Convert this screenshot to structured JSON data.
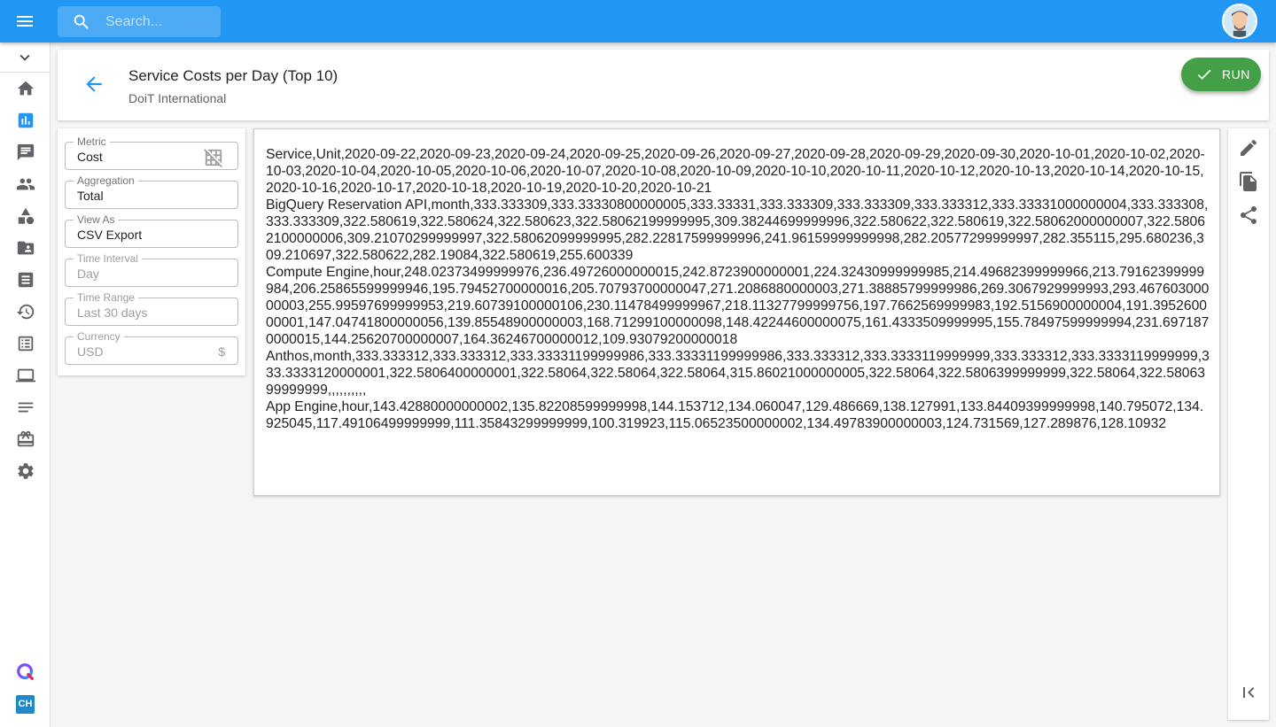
{
  "topbar": {
    "search_placeholder": "Search...",
    "brand_color": "#2196f3"
  },
  "sidebar": {
    "items": [
      "home-icon",
      "reports-icon",
      "chat-icon",
      "people-icon",
      "shapes-icon",
      "folder-icon",
      "invoice-icon",
      "history-icon",
      "list-icon",
      "laptop-icon",
      "notes-icon",
      "briefcase-icon",
      "settings-icon"
    ],
    "active": "reports-icon",
    "bottom_apps": [
      "q-logo-icon",
      "ch-logo-icon"
    ],
    "ch_label": "CH"
  },
  "header": {
    "title": "Service Costs per Day (Top 10)",
    "subtitle": "DoiT International",
    "run_label": "RUN"
  },
  "config": {
    "metric": {
      "label": "Metric",
      "value": "Cost"
    },
    "aggregation": {
      "label": "Aggregation",
      "value": "Total"
    },
    "view_as": {
      "label": "View As",
      "value": "CSV Export"
    },
    "time_interval": {
      "label": "Time Interval",
      "value": "Day"
    },
    "time_range": {
      "label": "Time Range",
      "value": "Last 30 days"
    },
    "currency": {
      "label": "Currency",
      "value": "USD",
      "symbol": "$"
    }
  },
  "csv_output": "Service,Unit,2020-09-22,2020-09-23,2020-09-24,2020-09-25,2020-09-26,2020-09-27,2020-09-28,2020-09-29,2020-09-30,2020-10-01,2020-10-02,2020-10-03,2020-10-04,2020-10-05,2020-10-06,2020-10-07,2020-10-08,2020-10-09,2020-10-10,2020-10-11,2020-10-12,2020-10-13,2020-10-14,2020-10-15,2020-10-16,2020-10-17,2020-10-18,2020-10-19,2020-10-20,2020-10-21\nBigQuery Reservation API,month,333.333309,333.33330800000005,333.33331,333.333309,333.333309,333.333312,333.33331000000004,333.333308,333.333309,322.580619,322.580624,322.580623,322.58062199999995,309.38244699999996,322.580622,322.580619,322.58062000000007,322.58062100000006,309.21070299999997,322.58062099999995,282.22817599999996,241.96159999999998,282.20577299999997,282.355115,295.680236,309.210697,322.580622,282.19084,322.580619,255.600339\nCompute Engine,hour,248.02373499999976,236.49726000000015,242.8723900000001,224.32430999999985,214.49682399999966,213.79162399999984,206.25865599999946,195.79452700000016,205.70793700000047,271.2086880000003,271.38885799999986,269.3067929999993,293.46760300000003,255.99597699999953,219.60739100000106,230.11478499999967,218.11327799999756,197.7662569999983,192.5156900000004,191.395260000001,147.04741800000056,139.85548900000003,168.71299100000098,148.42244600000075,161.4333509999995,155.78497599999994,231.6971870000015,144.25620700000007,164.36246700000012,109.93079200000018\nAnthos,month,333.333312,333.333312,333.33331199999986,333.33331199999986,333.333312,333.3333119999999,333.333312,333.3333119999999,333.3333120000001,322.5806400000001,322.58064,322.58064,322.58064,315.86021000000005,322.58064,322.5806399999999,322.58064,322.5806399999999,,,,,,,,,,\nApp Engine,hour,143.42880000000002,135.82208599999998,144.153712,134.060047,129.486669,138.127991,133.84409399999998,140.795072,134.925045,117.49106499999999,111.35843299999999,100.319923,115.06523500000002,134.49783900000003,124.731569,127.289876,128.10932",
  "rail": {
    "tools": [
      "edit-icon",
      "copy-icon",
      "share-icon"
    ],
    "collapse": "collapse-left-icon"
  }
}
